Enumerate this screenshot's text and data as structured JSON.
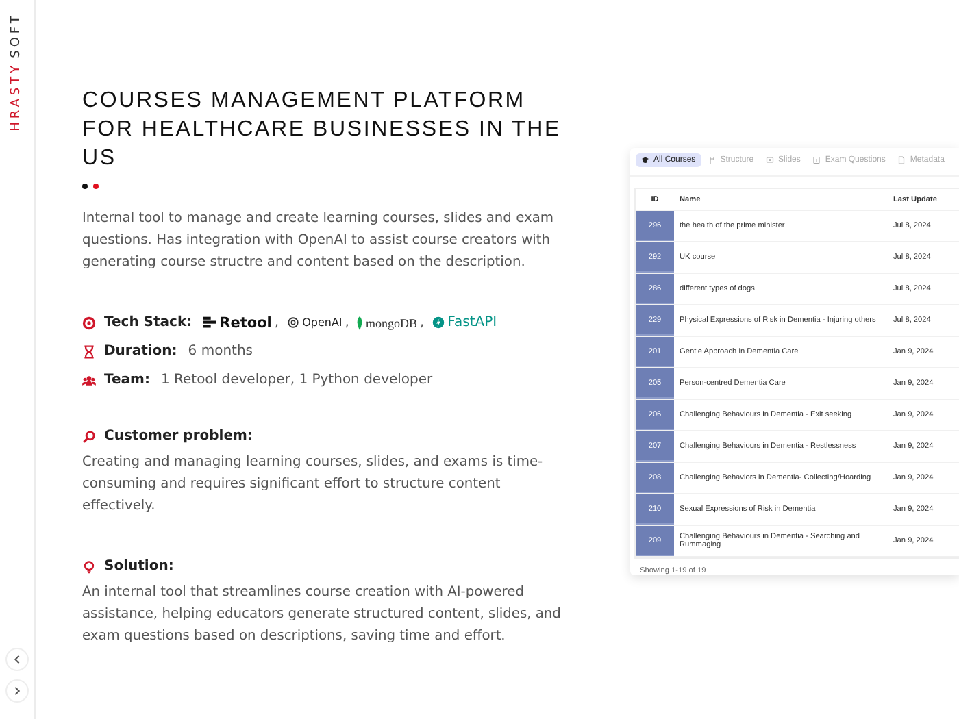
{
  "logo": {
    "first": "HRASTY",
    "second": "SOFT"
  },
  "title": "COURSES MANAGEMENT PLATFORM FOR HEALTHCARE BUSINESSES IN THE US",
  "description": "Internal tool to manage and create learning courses, slides and exam questions. Has integration with OpenAI to assist course creators with generating course structre and content based on the description.",
  "facts": [
    {
      "kind": "stack",
      "label": "Tech Stack:",
      "items": [
        {
          "kind": "retool",
          "label": "Retool",
          "suffix": ","
        },
        {
          "kind": "openai",
          "label": "OpenAI",
          "suffix": ","
        },
        {
          "kind": "mongodb",
          "label": "mongoDB",
          "suffix": ","
        },
        {
          "kind": "fastapi",
          "label": "FastAPI"
        }
      ]
    },
    {
      "kind": "duration",
      "label": "Duration:",
      "value": "6 months"
    },
    {
      "kind": "team",
      "label": "Team:",
      "value": "1 Retool developer, 1 Python developer"
    }
  ],
  "sections": [
    {
      "kind": "problem",
      "heading": "Customer problem:",
      "text": "Creating and managing learning courses, slides, and exams is time-consuming and requires significant effort to structure content effectively."
    },
    {
      "kind": "solution",
      "heading": "Solution:",
      "text": "An internal tool that streamlines course creation with AI-powered assistance, helping educators generate structured content, slides, and exam questions based on descriptions, saving time and effort."
    }
  ],
  "app_screenshot": {
    "tabs": [
      {
        "kind": "courses",
        "label": "All Courses",
        "selected": true
      },
      {
        "kind": "structure",
        "label": "Structure",
        "selected": false
      },
      {
        "kind": "slides",
        "label": "Slides",
        "selected": false
      },
      {
        "kind": "exam",
        "label": "Exam Questions",
        "selected": false
      },
      {
        "kind": "metadata",
        "label": "Metadata",
        "selected": false
      }
    ],
    "table": {
      "columns": [
        "ID",
        "Name",
        "Last Update"
      ],
      "rows": [
        [
          "296",
          "the health of the prime minister",
          "Jul 8, 2024"
        ],
        [
          "292",
          "UK course",
          "Jul 8, 2024"
        ],
        [
          "286",
          "different types of dogs",
          "Jul 8, 2024"
        ],
        [
          "229",
          "Physical Expressions of Risk in Dementia - Injuring others",
          "Jul 8, 2024"
        ],
        [
          "201",
          "Gentle Approach in Dementia Care",
          "Jan 9, 2024"
        ],
        [
          "205",
          "Person-centred Dementia Care",
          "Jan 9, 2024"
        ],
        [
          "206",
          "Challenging Behaviours in Dementia - Exit seeking",
          "Jan 9, 2024"
        ],
        [
          "207",
          "Challenging Behaviours in Dementia - Restlessness",
          "Jan 9, 2024"
        ],
        [
          "208",
          "Challenging Behaviors in Dementia- Collecting/Hoarding",
          "Jan 9, 2024"
        ],
        [
          "210",
          "Sexual Expressions of Risk in Dementia",
          "Jan 9, 2024"
        ],
        [
          "209",
          "Challenging Behaviours in Dementia - Searching and Rummaging",
          "Jan 9, 2024"
        ]
      ],
      "footer": "Showing 1-19 of 19"
    }
  }
}
